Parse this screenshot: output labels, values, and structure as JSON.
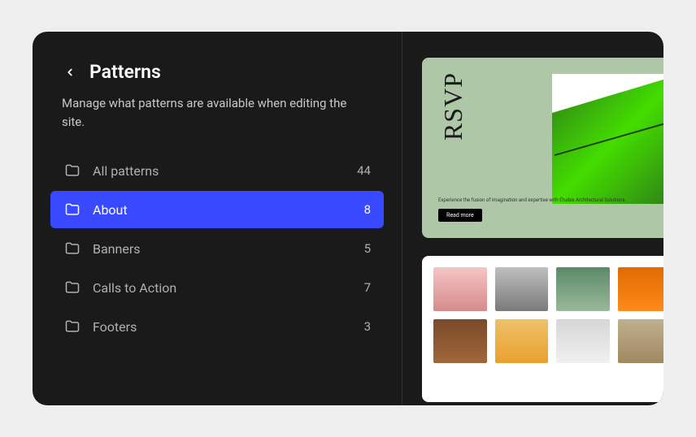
{
  "header": {
    "title": "Patterns",
    "subtitle": "Manage what patterns are available when editing the site."
  },
  "items": [
    {
      "label": "All patterns",
      "count": 44,
      "selected": false
    },
    {
      "label": "About",
      "count": 8,
      "selected": true
    },
    {
      "label": "Banners",
      "count": 5,
      "selected": false
    },
    {
      "label": "Calls to Action",
      "count": 7,
      "selected": false
    },
    {
      "label": "Footers",
      "count": 3,
      "selected": false
    }
  ],
  "preview": {
    "card1": {
      "heading": "RSVP",
      "desc": "Experience the fusion of imagination and expertise with Études Architectural Solutions.",
      "button": "Read more"
    }
  },
  "colors": {
    "accent": "#3949ff"
  }
}
